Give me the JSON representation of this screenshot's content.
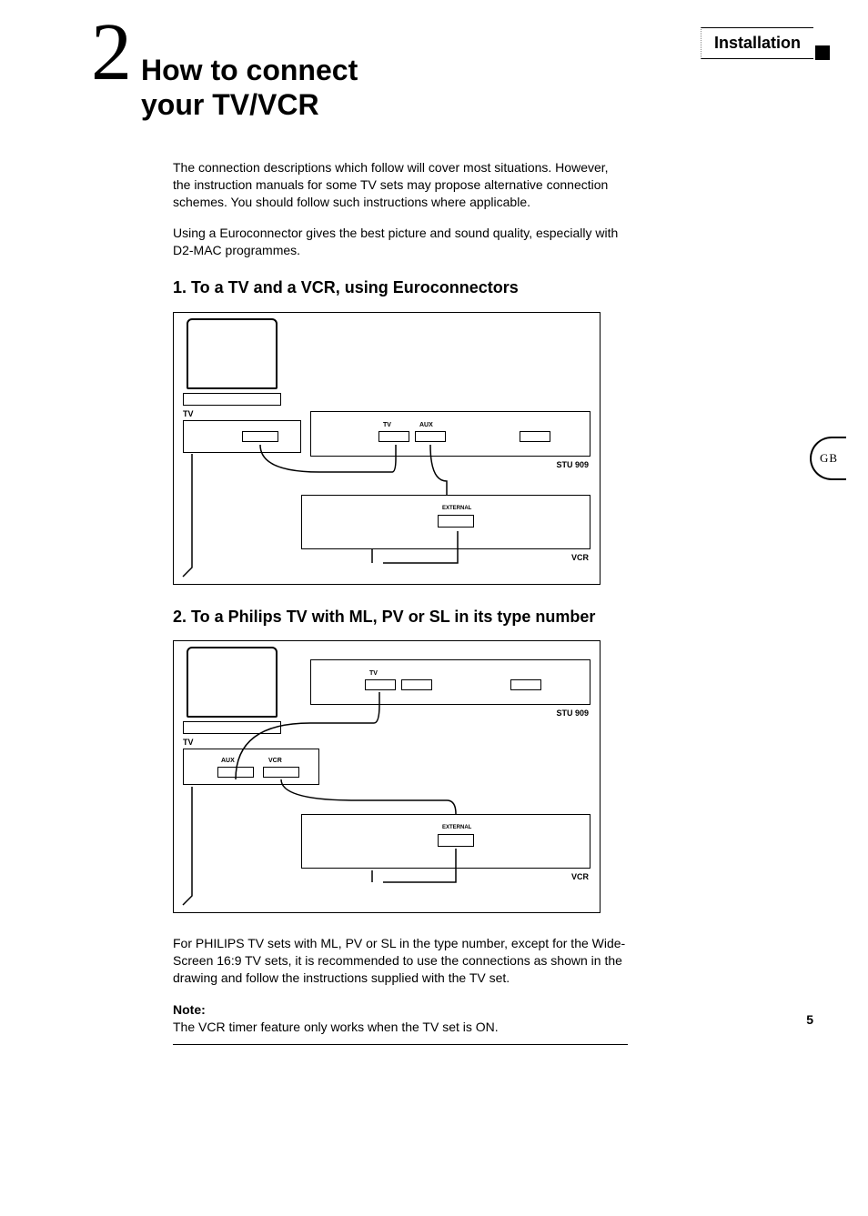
{
  "header": {
    "chapter_number": "2",
    "chapter_title_line1": "How to connect",
    "chapter_title_line2": "your TV/VCR",
    "section_label": "Installation",
    "language_tab": "GB"
  },
  "intro": {
    "para1": "The connection descriptions which follow will cover most situations. However, the instruction manuals for some TV sets may propose alternative connection schemes. You should follow such instructions where applicable.",
    "para2": "Using a Euroconnector gives the best picture and sound quality, especially with D2-MAC programmes."
  },
  "section1": {
    "heading": "1. To a TV and a VCR, using Euroconnectors",
    "diagram": {
      "tv_label": "TV",
      "receiver_label": "STU 909",
      "vcr_label": "VCR",
      "port_tv": "TV",
      "port_aux": "AUX",
      "port_external": "EXTERNAL"
    }
  },
  "section2": {
    "heading": "2. To a Philips TV with ML, PV or SL in its type number",
    "diagram": {
      "tv_label": "TV",
      "receiver_label": "STU 909",
      "vcr_label": "VCR",
      "port_aux": "AUX",
      "port_vcr": "VCR",
      "port_tv": "TV",
      "port_external": "EXTERNAL"
    },
    "para": "For PHILIPS TV sets with ML, PV or SL in the type number, except for the Wide-Screen 16:9 TV sets, it is recommended to use the connections as shown in the drawing and follow the instructions supplied with the TV set.",
    "note_label": "Note:",
    "note_text": "The VCR timer feature only works when the TV set is ON."
  },
  "page_number": "5"
}
